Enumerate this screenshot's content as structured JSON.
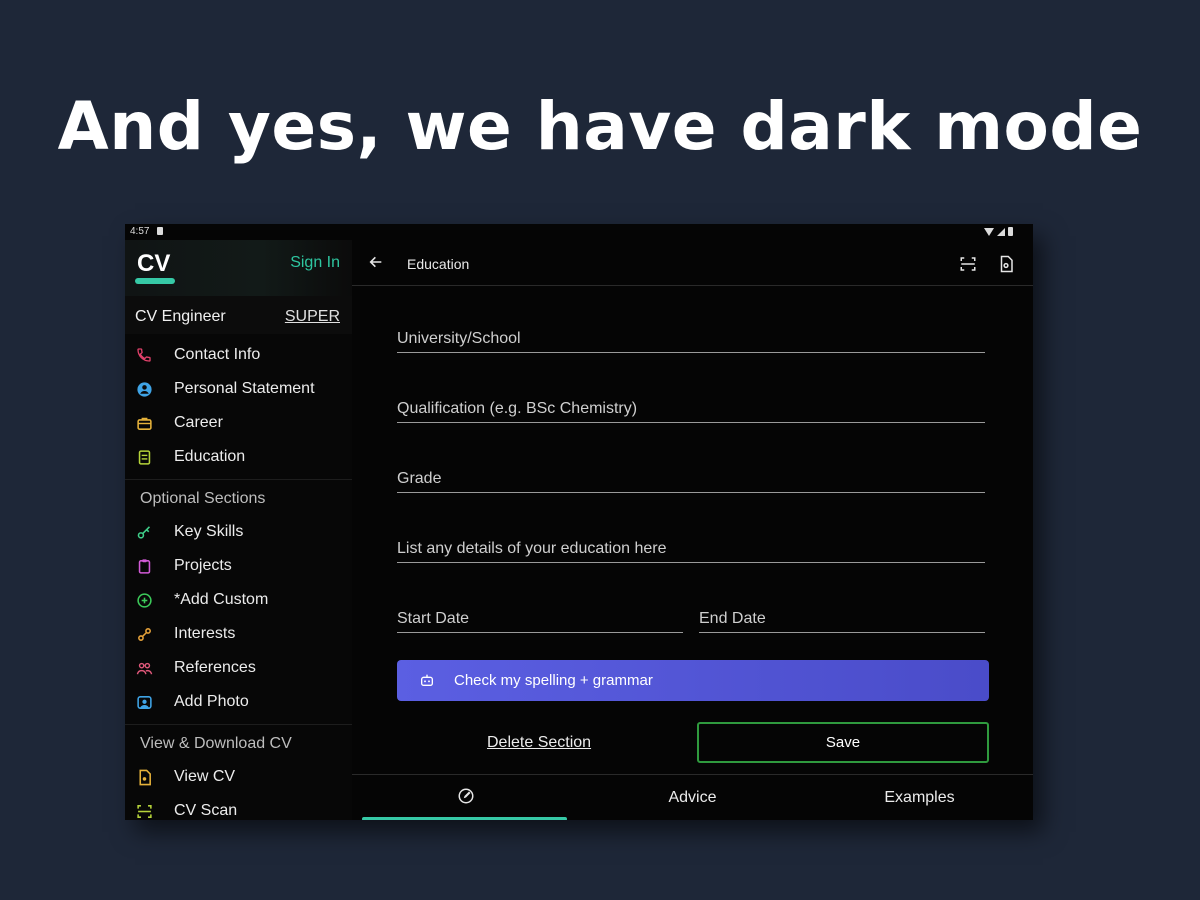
{
  "headline": "And yes, we have dark mode",
  "status_bar": {
    "time": "4:57"
  },
  "sidebar": {
    "logo": "CV",
    "sign_in": "Sign In",
    "account_name": "CV Engineer",
    "account_badge": "SUPER",
    "main_items": [
      {
        "label": "Contact Info",
        "icon": "phone-icon",
        "color": "#e0406a"
      },
      {
        "label": "Personal Statement",
        "icon": "person-icon",
        "color": "#3fa4e6"
      },
      {
        "label": "Career",
        "icon": "briefcase-icon",
        "color": "#e6b23a"
      },
      {
        "label": "Education",
        "icon": "school-icon",
        "color": "#b6d43a"
      }
    ],
    "optional_title": "Optional Sections",
    "optional_items": [
      {
        "label": "Key Skills",
        "icon": "key-icon",
        "color": "#3fcf8a"
      },
      {
        "label": "Projects",
        "icon": "clipboard-icon",
        "color": "#d25ad6"
      },
      {
        "label": "*Add Custom",
        "icon": "add-circle-icon",
        "color": "#3ccb5a"
      },
      {
        "label": "Interests",
        "icon": "interests-icon",
        "color": "#e6a23a"
      },
      {
        "label": "References",
        "icon": "people-icon",
        "color": "#e0587a"
      },
      {
        "label": "Add Photo",
        "icon": "photo-icon",
        "color": "#3fa4e6"
      }
    ],
    "view_title": "View & Download CV",
    "view_items": [
      {
        "label": "View CV",
        "icon": "doc-icon",
        "color": "#e6b23a"
      },
      {
        "label": "CV Scan",
        "icon": "scan-icon",
        "color": "#b6d43a"
      }
    ]
  },
  "main": {
    "title": "Education",
    "fields": {
      "school": "University/School",
      "qualification": "Qualification (e.g. BSc Chemistry)",
      "grade": "Grade",
      "details": "List any details of your education here",
      "start_date": "Start Date",
      "end_date": "End Date"
    },
    "spell_button": "Check my spelling + grammar",
    "delete_link": "Delete Section",
    "save_button": "Save",
    "tabs": {
      "advice": "Advice",
      "examples": "Examples"
    }
  },
  "colors": {
    "accent": "#36c9a6",
    "spell_button": "#5b5fe2",
    "save_border": "#2f9a3e",
    "background": "#1e2738"
  }
}
